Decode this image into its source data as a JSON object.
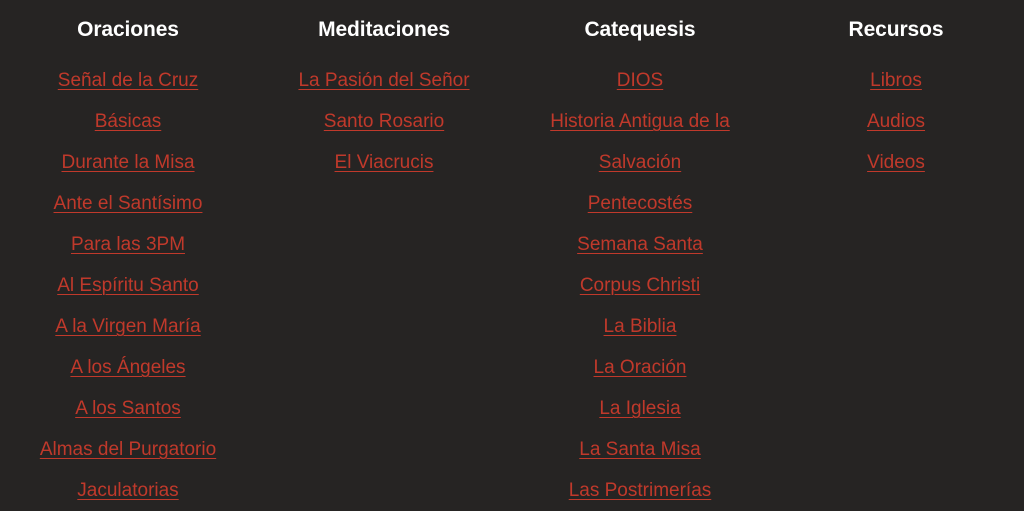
{
  "page": {
    "background_color": "#262423",
    "heading_color": "#ffffff",
    "link_color": "#c0392b"
  },
  "columns": [
    {
      "title": "Oraciones",
      "links": [
        "Señal de la Cruz",
        "Básicas",
        "Durante la Misa",
        "Ante el Santísimo",
        "Para las 3PM",
        "Al Espíritu Santo",
        "A la Virgen María",
        "A los Ángeles",
        "A los Santos",
        "Almas del Purgatorio",
        "Jaculatorias"
      ]
    },
    {
      "title": "Meditaciones",
      "links": [
        "La Pasión del Señor",
        "Santo Rosario",
        "El Viacrucis"
      ]
    },
    {
      "title": "Catequesis",
      "links": [
        "DIOS",
        "Historia Antigua de la Salvación",
        "Pentecostés",
        "Semana Santa",
        "Corpus Christi",
        "La Biblia",
        "La Oración",
        "La Iglesia",
        "La Santa Misa",
        "Las Postrimerías"
      ]
    },
    {
      "title": "Recursos",
      "links": [
        "Libros",
        "Audios",
        "Videos"
      ]
    }
  ]
}
